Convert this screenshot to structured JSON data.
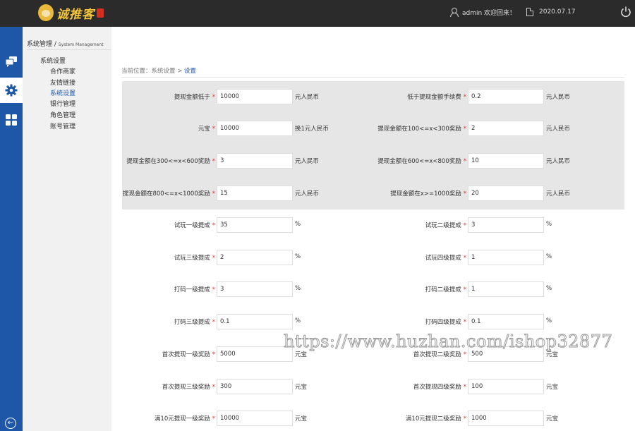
{
  "header": {
    "logo_text": "诚推客",
    "user_text": "admin 欢迎回来！",
    "date": "2020.07.17"
  },
  "icons": {
    "user": "user-icon",
    "date": "document-icon",
    "power": "power-icon",
    "rail": [
      "chat-icon",
      "gear-icon",
      "grid-icon",
      "back-arrow-icon"
    ]
  },
  "colors": {
    "accent": "#1f57a8",
    "topbar": "#2b2b2b",
    "required": "#dd3333"
  },
  "menu": {
    "title": "系统管理 / ",
    "subtitle": "System Management",
    "group": "系统设置",
    "items": [
      "合作商家",
      "友情链接",
      "系统设置",
      "银行管理",
      "角色管理",
      "账号管理"
    ],
    "active_index": 2
  },
  "breadcrumb": {
    "prefix": "当前位置：系统设置 > ",
    "current": "设置"
  },
  "form": {
    "rows": [
      {
        "left": {
          "label": "提现金额低于",
          "value": "10000",
          "unit": "元人民币"
        },
        "right": {
          "label": "低于提现金额手续费",
          "value": "0.2",
          "unit": "元人民币"
        }
      },
      {
        "left": {
          "label": "元宝",
          "value": "10000",
          "unit": "换1元人民币"
        },
        "right": {
          "label": "提现金额在100<=x<300奖励",
          "value": "2",
          "unit": "元人民币"
        }
      },
      {
        "left": {
          "label": "提现金额在300<=x<600奖励",
          "value": "3",
          "unit": "元人民币"
        },
        "right": {
          "label": "提现金额在600<=x<800奖励",
          "value": "10",
          "unit": "元人民币"
        }
      },
      {
        "left": {
          "label": "提现金额在800<=x<1000奖励",
          "value": "15",
          "unit": "元人民币"
        },
        "right": {
          "label": "提现金额在x>=1000奖励",
          "value": "20",
          "unit": "元人民币"
        }
      },
      {
        "left": {
          "label": "试玩一级提成",
          "value": "35",
          "unit": "%"
        },
        "right": {
          "label": "试玩二级提成",
          "value": "3",
          "unit": "%"
        }
      },
      {
        "left": {
          "label": "试玩三级提成",
          "value": "2",
          "unit": "%"
        },
        "right": {
          "label": "试玩四级提成",
          "value": "1",
          "unit": "%"
        }
      },
      {
        "left": {
          "label": "打码一级提成",
          "value": "3",
          "unit": "%"
        },
        "right": {
          "label": "打码二级提成",
          "value": "1",
          "unit": "%"
        }
      },
      {
        "left": {
          "label": "打码三级提成",
          "value": "0.1",
          "unit": "%"
        },
        "right": {
          "label": "打码四级提成",
          "value": "0.1",
          "unit": "%"
        }
      },
      {
        "left": {
          "label": "首次提现一级奖励",
          "value": "5000",
          "unit": "元宝"
        },
        "right": {
          "label": "首次提现二级奖励",
          "value": "500",
          "unit": "元宝"
        }
      },
      {
        "left": {
          "label": "首次提现三级奖励",
          "value": "300",
          "unit": "元宝"
        },
        "right": {
          "label": "首次提现四级奖励",
          "value": "100",
          "unit": "元宝"
        }
      },
      {
        "left": {
          "label": "满10元提现一级奖励",
          "value": "10000",
          "unit": "元宝"
        },
        "right": {
          "label": "满10元提现二级奖励",
          "value": "1000",
          "unit": "元宝"
        }
      }
    ]
  },
  "watermark": "https://www.huzhan.com/ishop32877"
}
